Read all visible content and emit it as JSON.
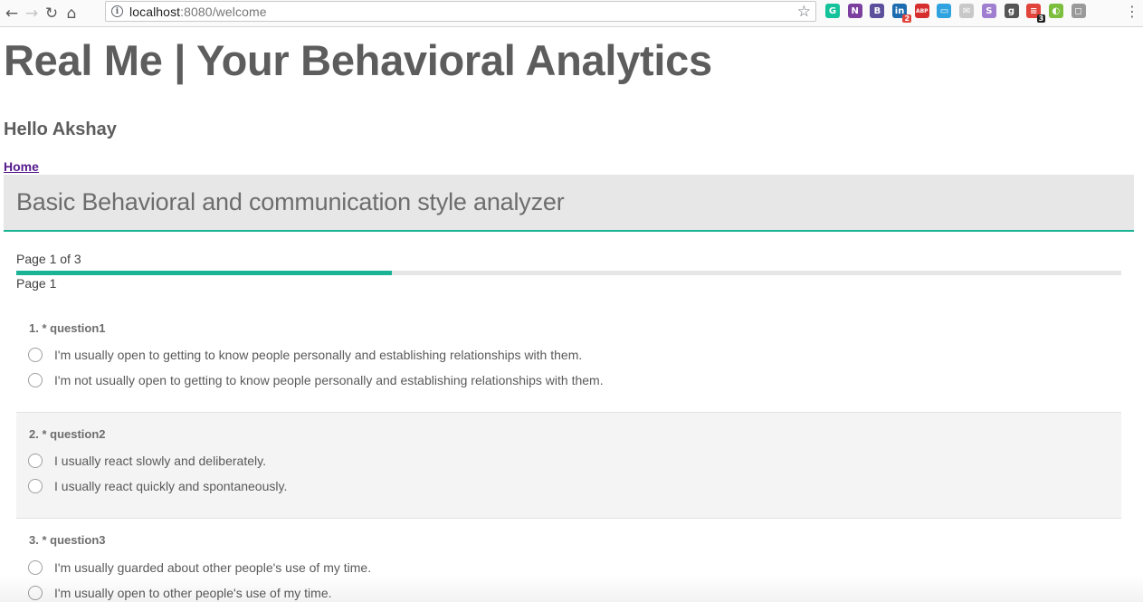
{
  "browser": {
    "url_host": "localhost",
    "url_rest": ":8080/welcome",
    "extensions": [
      {
        "name": "grammarly-icon",
        "glyph": "G",
        "color": "#15c39a",
        "badge": ""
      },
      {
        "name": "onenote-icon",
        "glyph": "N",
        "color": "#7b3fa0",
        "badge": ""
      },
      {
        "name": "bold-b-icon",
        "glyph": "B",
        "color": "#5c4f9c",
        "badge": ""
      },
      {
        "name": "linkedin-icon",
        "glyph": "in",
        "color": "#1d6cb0",
        "badge": "2"
      },
      {
        "name": "adblock-icon",
        "glyph": "ABP",
        "color": "#d62e2e",
        "badge": ""
      },
      {
        "name": "window-icon",
        "glyph": "▭",
        "color": "#2fa3e0",
        "badge": ""
      },
      {
        "name": "mail-icon",
        "glyph": "✉",
        "color": "#c8c8c8",
        "badge": ""
      },
      {
        "name": "s-icon",
        "glyph": "S",
        "color": "#a07fd0",
        "badge": ""
      },
      {
        "name": "g-icon",
        "glyph": "g",
        "color": "#555555",
        "badge": ""
      },
      {
        "name": "todoist-icon",
        "glyph": "≡",
        "color": "#e0443a",
        "badge": "3"
      },
      {
        "name": "green-ext-icon",
        "glyph": "◐",
        "color": "#7cbf3e",
        "badge": ""
      },
      {
        "name": "gray-ext-icon",
        "glyph": "◻",
        "color": "#9a9a9a",
        "badge": ""
      }
    ]
  },
  "app": {
    "title": "Real Me | Your Behavioral Analytics",
    "greeting": "Hello Akshay",
    "home_link": "Home"
  },
  "survey": {
    "title": "Basic Behavioral and communication style analyzer",
    "page_indicator": "Page 1 of 3",
    "progress": 0.34,
    "page_name": "Page 1",
    "questions": [
      {
        "title": "1. * question1",
        "choices": [
          "I'm usually open to getting to know people personally and establishing relationships with them.",
          "I'm not usually open to getting to know people personally and establishing relationships with them."
        ]
      },
      {
        "title": "2. * question2",
        "choices": [
          "I usually react slowly and deliberately.",
          "I usually react quickly and spontaneously."
        ]
      },
      {
        "title": "3. * question3",
        "choices": [
          "I'm usually guarded about other people's use of my time.",
          "I'm usually open to other people's use of my time."
        ]
      }
    ]
  },
  "colors": {
    "accent": "#1ab394",
    "header_bg": "#e7e7e7",
    "text": "#606060"
  }
}
